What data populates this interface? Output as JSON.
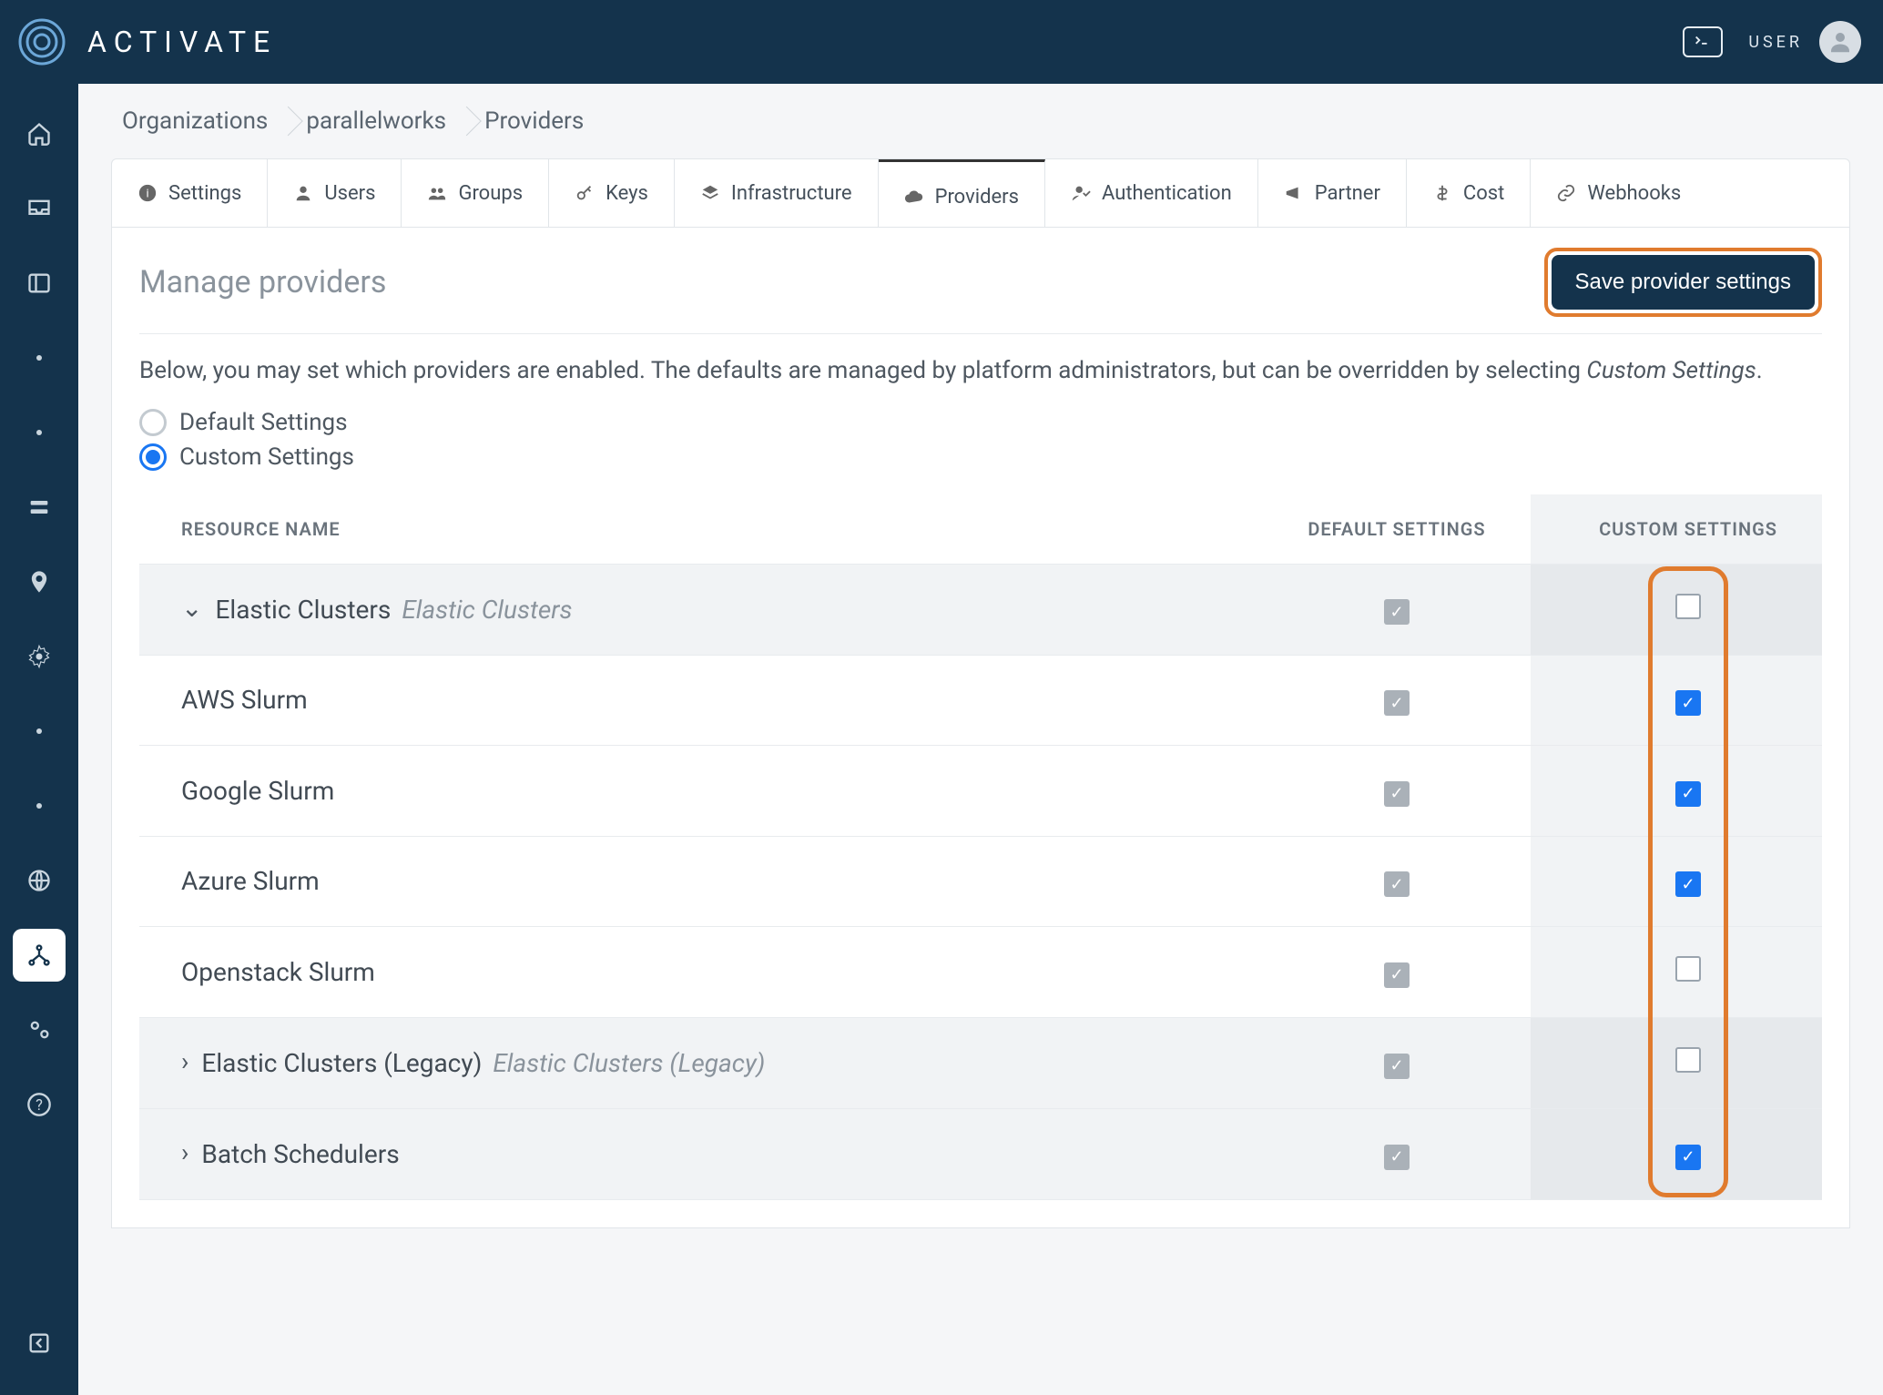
{
  "brand": "ACTIVATE",
  "topbar": {
    "user_label": "USER"
  },
  "breadcrumbs": [
    "Organizations",
    "parallelworks",
    "Providers"
  ],
  "tabs": [
    {
      "label": "Settings",
      "icon": "info"
    },
    {
      "label": "Users",
      "icon": "user"
    },
    {
      "label": "Groups",
      "icon": "group"
    },
    {
      "label": "Keys",
      "icon": "key"
    },
    {
      "label": "Infrastructure",
      "icon": "layers"
    },
    {
      "label": "Providers",
      "icon": "cloud",
      "active": true
    },
    {
      "label": "Authentication",
      "icon": "user-check"
    },
    {
      "label": "Partner",
      "icon": "megaphone"
    },
    {
      "label": "Cost",
      "icon": "dollar"
    },
    {
      "label": "Webhooks",
      "icon": "link"
    }
  ],
  "page": {
    "title": "Manage providers",
    "save_button": "Save provider settings",
    "description_prefix": "Below, you may set which providers are enabled. The defaults are managed by platform administrators, but can be overridden by selecting ",
    "description_em": "Custom Settings",
    "description_suffix": "."
  },
  "settings_mode": {
    "default_label": "Default Settings",
    "custom_label": "Custom Settings",
    "selected": "custom"
  },
  "table": {
    "headers": {
      "name": "RESOURCE NAME",
      "default": "DEFAULT SETTINGS",
      "custom": "CUSTOM SETTINGS"
    },
    "rows": [
      {
        "kind": "group",
        "expanded": true,
        "name": "Elastic Clusters",
        "subtitle": "Elastic Clusters",
        "default": true,
        "custom": false
      },
      {
        "kind": "item",
        "name": "AWS Slurm",
        "default": true,
        "custom": true
      },
      {
        "kind": "item",
        "name": "Google Slurm",
        "default": true,
        "custom": true
      },
      {
        "kind": "item",
        "name": "Azure Slurm",
        "default": true,
        "custom": true
      },
      {
        "kind": "item",
        "name": "Openstack Slurm",
        "default": true,
        "custom": false
      },
      {
        "kind": "group",
        "expanded": false,
        "name": "Elastic Clusters (Legacy)",
        "subtitle": "Elastic Clusters (Legacy)",
        "default": true,
        "custom": false
      },
      {
        "kind": "group",
        "expanded": false,
        "name": "Batch Schedulers",
        "subtitle": "",
        "default": true,
        "custom": true
      }
    ]
  }
}
